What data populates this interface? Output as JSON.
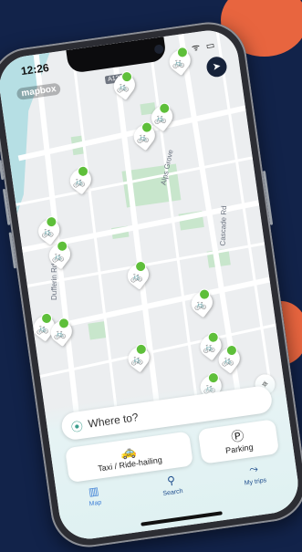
{
  "status_bar": {
    "time": "12:26",
    "icons": "• ᯤ ▭"
  },
  "map": {
    "attribution": "mapbox",
    "road_shield": "A1286",
    "streets": [
      "Alps Grove",
      "Cascade Rd",
      "Dufferin Rd"
    ]
  },
  "search": {
    "placeholder": "Where to?",
    "icon": "pin-icon"
  },
  "actions": [
    {
      "label": "Taxi / Ride-hailing",
      "icon": "taxi-icon"
    },
    {
      "label": "Parking",
      "icon": "parking-icon"
    }
  ],
  "tabs": [
    {
      "label": "Map",
      "icon": "map-icon",
      "active": true
    },
    {
      "label": "Search",
      "icon": "search-icon",
      "active": false
    },
    {
      "label": "My trips",
      "icon": "route-icon",
      "active": false
    }
  ],
  "colors": {
    "accent": "#5ebf3a",
    "brand_orange": "#e8653f",
    "background": "#12234a"
  }
}
